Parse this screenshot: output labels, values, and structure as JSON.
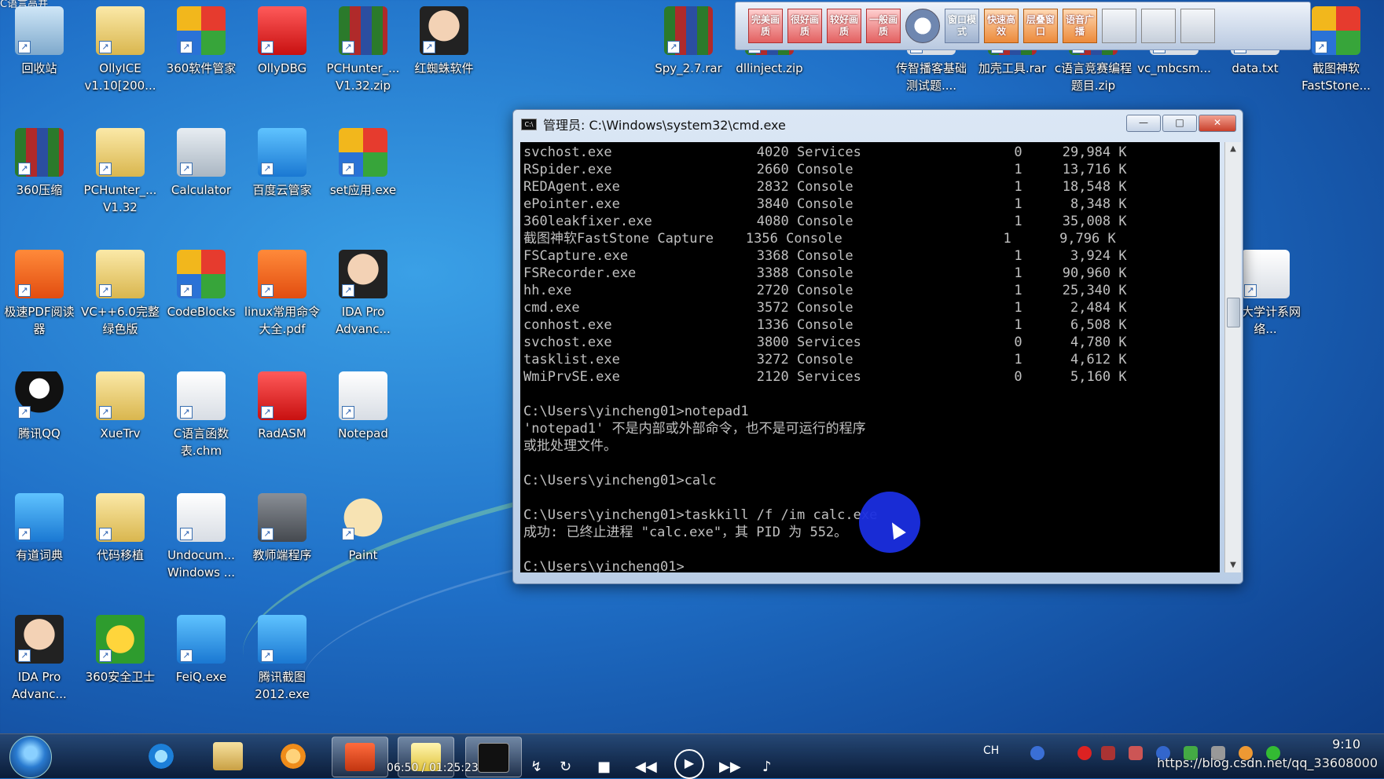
{
  "desktop": {
    "corner_text": "C语言高并",
    "icons": [
      {
        "label": "回收站",
        "icon": "recycle-bin-icon"
      },
      {
        "label": "OllyICE v1.10[200...",
        "icon": "folder-icon"
      },
      {
        "label": "360软件管家",
        "icon": "app-manager-icon"
      },
      {
        "label": "OllyDBG",
        "icon": "debugger-icon"
      },
      {
        "label": "PCHunter_... V1.32.zip",
        "icon": "archive-icon"
      },
      {
        "label": "红蜘蛛软件",
        "icon": "teacher-face-icon"
      },
      {
        "label": "360压缩",
        "icon": "archive-icon"
      },
      {
        "label": "PCHunter_... V1.32",
        "icon": "folder-icon"
      },
      {
        "label": "Calculator",
        "icon": "calculator-icon"
      },
      {
        "label": "百度云管家",
        "icon": "cloud-icon"
      },
      {
        "label": "set应用.exe",
        "icon": "office-icon"
      },
      {
        "label": "极速PDF阅读器",
        "icon": "pdf-icon"
      },
      {
        "label": "VC++6.0完整绿色版",
        "icon": "folder-icon"
      },
      {
        "label": "CodeBlocks",
        "icon": "codeblocks-icon"
      },
      {
        "label": "linux常用命令大全.pdf",
        "icon": "pdf-icon"
      },
      {
        "label": "IDA Pro Advanc...",
        "icon": "ida-icon"
      },
      {
        "label": "腾讯QQ",
        "icon": "qq-penguin-icon"
      },
      {
        "label": "XueTrv",
        "icon": "folder-icon"
      },
      {
        "label": "C语言函数表.chm",
        "icon": "help-file-icon"
      },
      {
        "label": "RadASM",
        "icon": "radasm-icon"
      },
      {
        "label": "Notepad",
        "icon": "notepad-icon"
      },
      {
        "label": "有道词典",
        "icon": "dictionary-icon"
      },
      {
        "label": "代码移植",
        "icon": "folder-icon"
      },
      {
        "label": "Undocum... Windows ...",
        "icon": "help-file-icon"
      },
      {
        "label": "教师端程序",
        "icon": "projector-icon"
      },
      {
        "label": "Paint",
        "icon": "paint-palette-icon"
      },
      {
        "label": "IDA Pro Advanc...",
        "icon": "ida-icon"
      },
      {
        "label": "360安全卫士",
        "icon": "shield-plus-icon"
      },
      {
        "label": "FeiQ.exe",
        "icon": "chat-icon"
      },
      {
        "label": "腾讯截图 2012.exe",
        "icon": "screenshot-icon"
      },
      {
        "label": "Spy_2.7.rar",
        "icon": "archive-icon"
      },
      {
        "label": "dllinject.zip",
        "icon": "archive-icon"
      },
      {
        "label": "传智播客基础测试题....",
        "icon": "document-icon"
      },
      {
        "label": "加壳工具.rar",
        "icon": "archive-icon"
      },
      {
        "label": "c语言竞赛编程题目.zip",
        "icon": "archive-icon"
      },
      {
        "label": "vc_mbcsm...",
        "icon": "installer-icon"
      },
      {
        "label": "data.txt",
        "icon": "text-file-icon"
      },
      {
        "label": "截图神软 FastStone...",
        "icon": "faststone-icon"
      },
      {
        "label": "华大学计系网络...",
        "icon": "help-file-icon"
      }
    ]
  },
  "toolbar": {
    "buttons": [
      "完美画质",
      "很好画质",
      "较好画质",
      "一般画质",
      "",
      "窗口模式",
      "快速高效",
      "层叠窗口",
      "语音广播"
    ]
  },
  "cmd": {
    "title": "管理员: C:\\Windows\\system32\\cmd.exe",
    "title_icon": "C:\\",
    "minimize": "—",
    "maximize": "□",
    "close": "✕",
    "lines": [
      "svchost.exe                  4020 Services                   0     29,984 K",
      "RSpider.exe                  2660 Console                    1     13,716 K",
      "REDAgent.exe                 2832 Console                    1     18,548 K",
      "ePointer.exe                 3840 Console                    1      8,348 K",
      "360leakfixer.exe             4080 Console                    1     35,008 K",
      "截图神软FastStone Capture    1356 Console                    1      9,796 K",
      "FSCapture.exe                3368 Console                    1      3,924 K",
      "FSRecorder.exe               3388 Console                    1     90,960 K",
      "hh.exe                       2720 Console                    1     25,340 K",
      "cmd.exe                      3572 Console                    1      2,484 K",
      "conhost.exe                  1336 Console                    1      6,508 K",
      "svchost.exe                  3800 Services                   0      4,780 K",
      "tasklist.exe                 3272 Console                    1      4,612 K",
      "WmiPrvSE.exe                 2120 Services                   0      5,160 K",
      "",
      "C:\\Users\\yincheng01>notepad1",
      "'notepad1' 不是内部或外部命令，也不是可运行的程序",
      "或批处理文件。",
      "",
      "C:\\Users\\yincheng01>calc",
      "",
      "C:\\Users\\yincheng01>taskkill /f /im calc.exe",
      "成功: 已终止进程 \"calc.exe\"，其 PID 为 552。",
      "",
      "C:\\Users\\yincheng01>"
    ]
  },
  "taskbar": {
    "player_time": "06:50 / 01:25:23",
    "language": "CH",
    "clock": "9:10",
    "watermark": "https://blog.csdn.net/qq_33608000"
  }
}
